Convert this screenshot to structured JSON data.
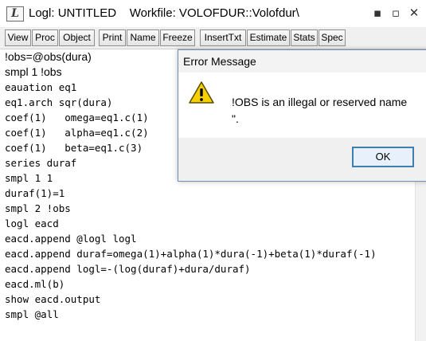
{
  "window": {
    "title": "Logl: UNTITLED    Workfile: VOLOFDUR::Volofdur\\",
    "minimize_glyph": "▪",
    "restore_glyph": "▫",
    "close_glyph": "✕"
  },
  "toolbar": {
    "buttons": [
      "View",
      "Proc",
      "Object",
      "Print",
      "Name",
      "Freeze",
      "InsertTxt",
      "Estimate",
      "Stats",
      "Spec"
    ]
  },
  "editor": {
    "lines": [
      "!obs=@obs(dura)",
      "smpl 1 !obs",
      "eauation eq1",
      "eq1.arch sqr(dura)",
      "coef(1)   omega=eq1.c(1)",
      "coef(1)   alpha=eq1.c(2)",
      "coef(1)   beta=eq1.c(3)",
      "series duraf",
      "smpl 1 1",
      "duraf(1)=1",
      "smpl 2 !obs",
      "logl eacd",
      "eacd.append @logl logl",
      "eacd.append duraf=omega(1)+alpha(1)*dura(-1)+beta(1)*duraf(-1)",
      "eacd.append logl=-(log(duraf)+dura/duraf)",
      "eacd.ml(b)",
      "show eacd.output",
      "smpl @all"
    ]
  },
  "dialog": {
    "title": "Error Message",
    "message_line1": "!OBS is an illegal or reserved name",
    "message_line2": "\".",
    "ok_label": "OK",
    "icon": "warning-icon"
  },
  "colors": {
    "dialog_border": "#6f8fb6",
    "ok_border": "#3c7fb1",
    "warning_yellow": "#f5d000"
  }
}
